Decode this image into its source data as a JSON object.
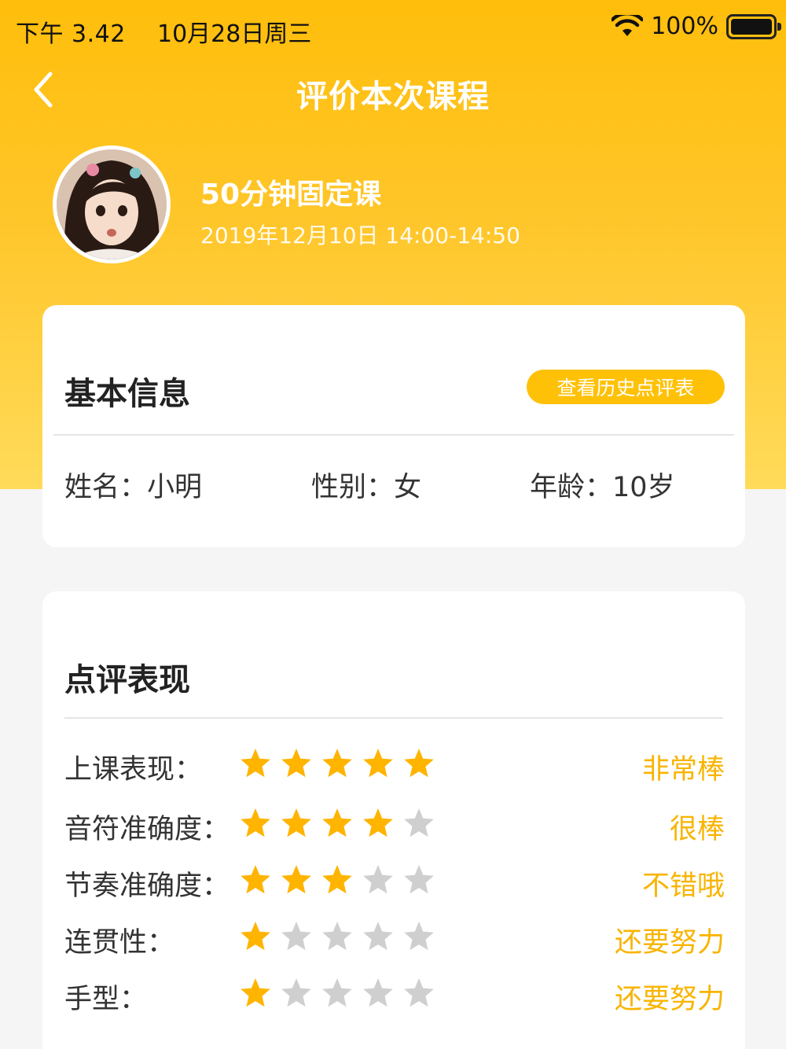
{
  "status_bar": {
    "time": "下午 3.42",
    "date": "10月28日周三",
    "battery": "100%",
    "wifi_icon": "wifi-icon",
    "battery_icon": "battery-icon"
  },
  "nav": {
    "back_icon": "chevron-left-icon",
    "title": "评价本次课程"
  },
  "course": {
    "name": "50分钟固定课",
    "time": "2019年12月10日 14:00-14:50"
  },
  "basic_info": {
    "heading": "基本信息",
    "history_button": "查看历史点评表",
    "name_field": "姓名：小明",
    "gender_field": "性别：女",
    "age_field": "年龄：10岁"
  },
  "review": {
    "heading": "点评表现",
    "max_stars": 5,
    "star_on_color": "#ffb400",
    "star_off_color": "#cfcfcf",
    "items": [
      {
        "label": "上课表现：",
        "stars": 5,
        "verdict": "非常棒"
      },
      {
        "label": "音符准确度：",
        "stars": 4,
        "verdict": "很棒"
      },
      {
        "label": "节奏准确度：",
        "stars": 3,
        "verdict": "不错哦"
      },
      {
        "label": "连贯性：",
        "stars": 1,
        "verdict": "还要努力"
      },
      {
        "label": "手型：",
        "stars": 1,
        "verdict": "还要努力"
      }
    ]
  },
  "colors": {
    "accent": "#ffc107",
    "verdict": "#f8b400"
  }
}
